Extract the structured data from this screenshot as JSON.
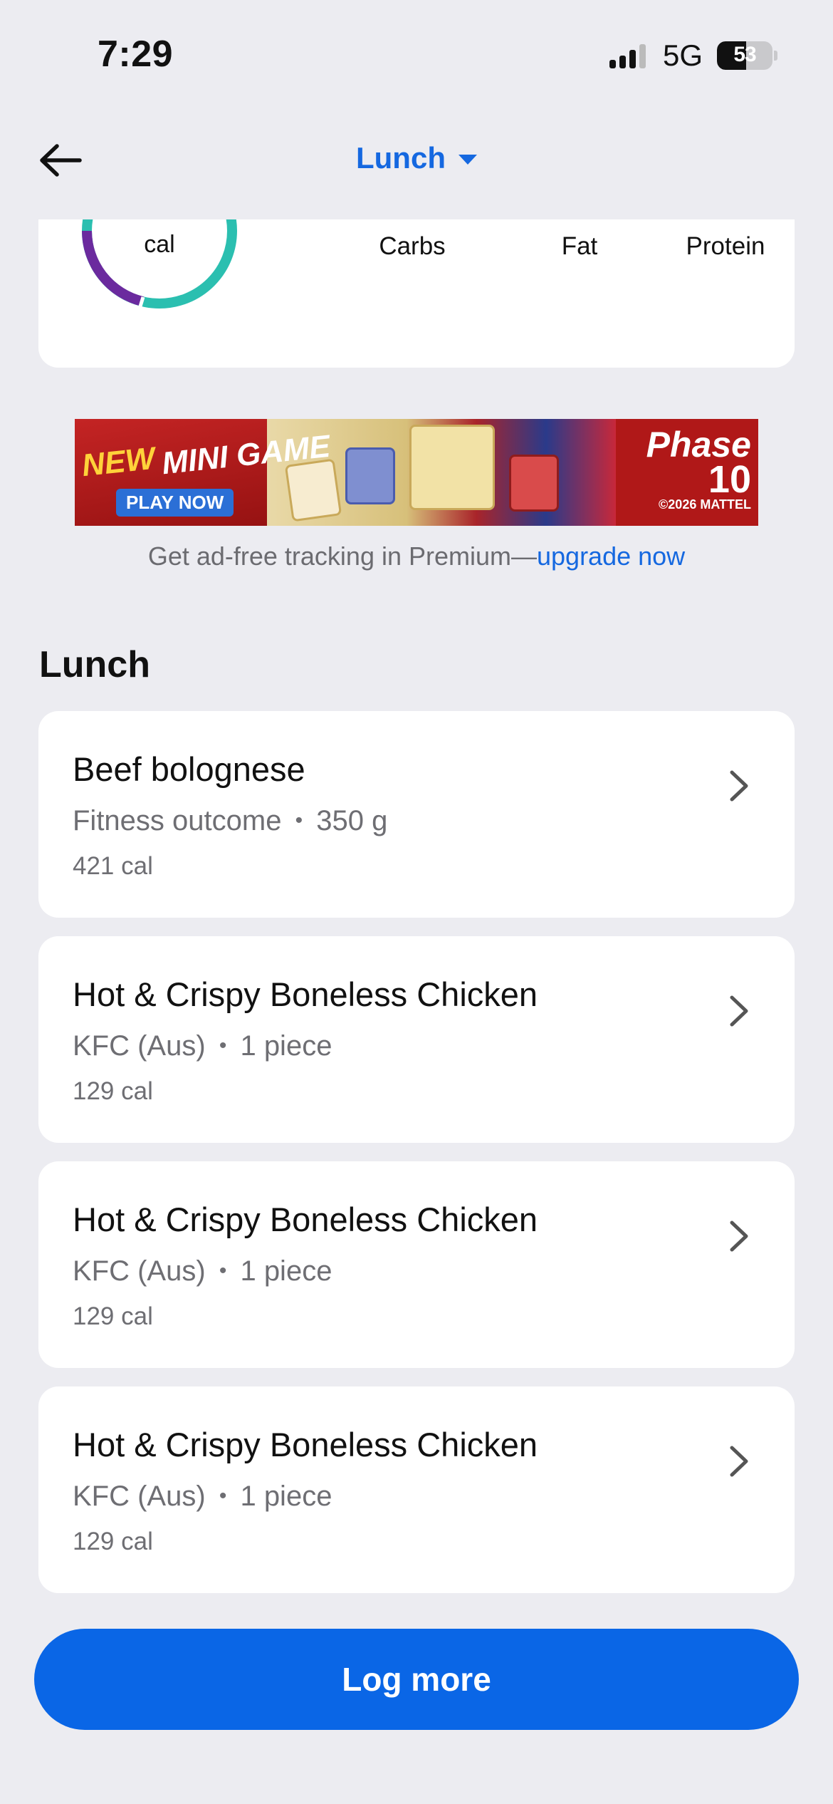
{
  "status_bar": {
    "time": "7:29",
    "network": "5G",
    "battery": "53",
    "battery_level": 0.53
  },
  "header": {
    "title": "Lunch"
  },
  "summary": {
    "ring_label": "cal",
    "macros": [
      {
        "label": "Carbs"
      },
      {
        "label": "Fat"
      },
      {
        "label": "Protein"
      }
    ],
    "colors": {
      "ring_teal": "#2BBFB0",
      "ring_purple": "#6B2A9E"
    }
  },
  "ad": {
    "headline_new": "NEW",
    "headline_rest": "MINI GAME",
    "cta": "PLAY NOW",
    "brand_line1": "Phase",
    "brand_line2": "10",
    "brand_line3": "©2026 MATTEL",
    "note_prefix": "Get ad-free tracking in Premium—",
    "note_link": "upgrade now"
  },
  "section": {
    "title": "Lunch"
  },
  "foods": [
    {
      "name": "Beef bolognese",
      "brand": "Fitness outcome",
      "serving": "350 g",
      "calories": "421 cal"
    },
    {
      "name": "Hot & Crispy Boneless Chicken",
      "brand": "KFC (Aus)",
      "serving": "1 piece",
      "calories": "129 cal"
    },
    {
      "name": "Hot & Crispy Boneless Chicken",
      "brand": "KFC (Aus)",
      "serving": "1 piece",
      "calories": "129 cal"
    },
    {
      "name": "Hot & Crispy Boneless Chicken",
      "brand": "KFC (Aus)",
      "serving": "1 piece",
      "calories": "129 cal"
    }
  ],
  "meta_separator": "•",
  "actions": {
    "log_more": "Log more"
  },
  "colors": {
    "accent": "#1568E0",
    "button": "#0A66E6",
    "background": "#ECECF1"
  }
}
